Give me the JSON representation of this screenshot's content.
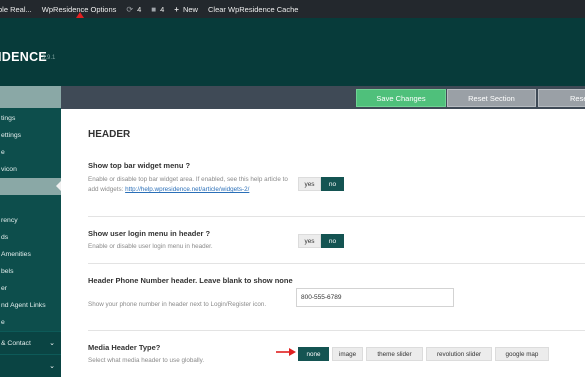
{
  "admin_bar": {
    "site_label": "ble Real...",
    "options_label": "WpResidence Options",
    "updates_count": "4",
    "comments_count": "4",
    "new_label": "New",
    "cache_label": "Clear WpResidence Cache"
  },
  "brand": {
    "name": "IDENCE",
    "version": "3.9.1"
  },
  "sidebar": {
    "top_label": "",
    "items": [
      "tings",
      "ettings",
      "e",
      "vicon",
      "",
      "",
      "rency",
      "ds",
      "Amenities",
      "bels",
      "er",
      "nd Agent Links",
      "e"
    ],
    "sections": [
      "& Contact",
      ""
    ]
  },
  "toolbar": {
    "save_label": "Save Changes",
    "reset_section_label": "Reset Section",
    "reset_all_label": "Rese"
  },
  "main": {
    "title": "HEADER",
    "rows": [
      {
        "label": "Show top bar widget menu ?",
        "desc_prefix": "Enable or disable top bar widget area. If enabled, see this help article to add widgets:",
        "desc_link": "http://help.wpresidence.net/article/widgets-2/",
        "yes": "yes",
        "no": "no"
      },
      {
        "label": "Show user login menu in header ?",
        "desc": "Enable or disable user login menu in header.",
        "yes": "yes",
        "no": "no"
      },
      {
        "label": "Header Phone Number header. Leave blank to show none",
        "desc": "Show your phone number in header next to Login/Register icon.",
        "value": "800-555-6789"
      },
      {
        "label": "Media Header Type?",
        "desc": "Select what media header to use globally.",
        "options": [
          "none",
          "image",
          "theme slider",
          "revolution slider",
          "google map"
        ],
        "selected": "none"
      }
    ]
  },
  "colors": {
    "brand_bg": "#073b3a",
    "sidebar_bg": "#0d4e4c",
    "save_green": "#4fc07b",
    "toggle_active": "#145452",
    "annotation_arrow": "#e02020"
  }
}
